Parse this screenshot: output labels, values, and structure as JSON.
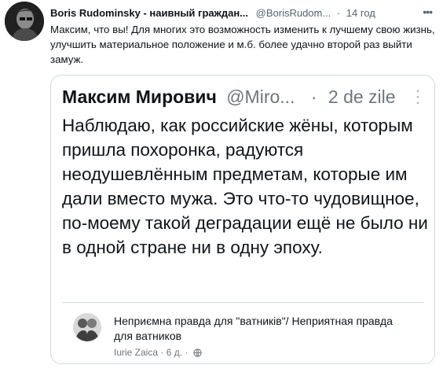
{
  "tweet": {
    "author": "Boris Rudominsky - наивный граждан...",
    "handle": "@BorisRudom...",
    "separator": "·",
    "time": "14 год",
    "more_icon": "more-horizontal-icon",
    "text": "Максим, что вы! Для многих это возможность изменить к лучшему свою жизнь, улучшить материальное положение и м.б. более удачно второй раз выйти замуж."
  },
  "quoted_post": {
    "author": "Максим Мирович",
    "handle": "@Miro...",
    "separator": "·",
    "time": "2 de zile",
    "more_icon": "more-vertical-icon",
    "text": "Наблюдаю, как российские жёны, которым пришла похоронка, радуются неодушевлённым предметам, которые им дали вместо мужа. Это что-то чудовищное, по-моему такой деградации ещё не было ни в одной стране ни в одну эпоху.",
    "page": {
      "title": "Неприємна правда для \"ватників\"/ Неприятная правда для ватников",
      "name": "Iurie Zaica",
      "separator": "·",
      "time": "6 д.",
      "meta_separator": "·",
      "privacy_icon": "globe-icon"
    }
  },
  "colors": {
    "text": "#0f1419",
    "secondary": "#536471",
    "border": "#cfd9de"
  }
}
